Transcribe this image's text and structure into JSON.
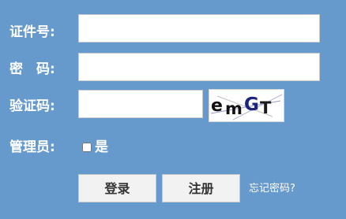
{
  "form": {
    "id_label": "证件号:",
    "password_label": "密　码:",
    "captcha_label": "验证码:",
    "admin_label": "管理员:",
    "admin_option": "是",
    "id_value": "",
    "password_value": "",
    "captcha_value": ""
  },
  "captcha": {
    "chars": [
      "e",
      "m",
      "G",
      "T"
    ],
    "colors": [
      "#111111",
      "#111111",
      "#1a237e",
      "#1a1a1a"
    ]
  },
  "buttons": {
    "login_label": "登录",
    "register_label": "注册"
  },
  "links": {
    "forgot_password": "忘记密码?"
  },
  "colors": {
    "background": "#6699cc",
    "button_face": "#f2f2f2"
  }
}
